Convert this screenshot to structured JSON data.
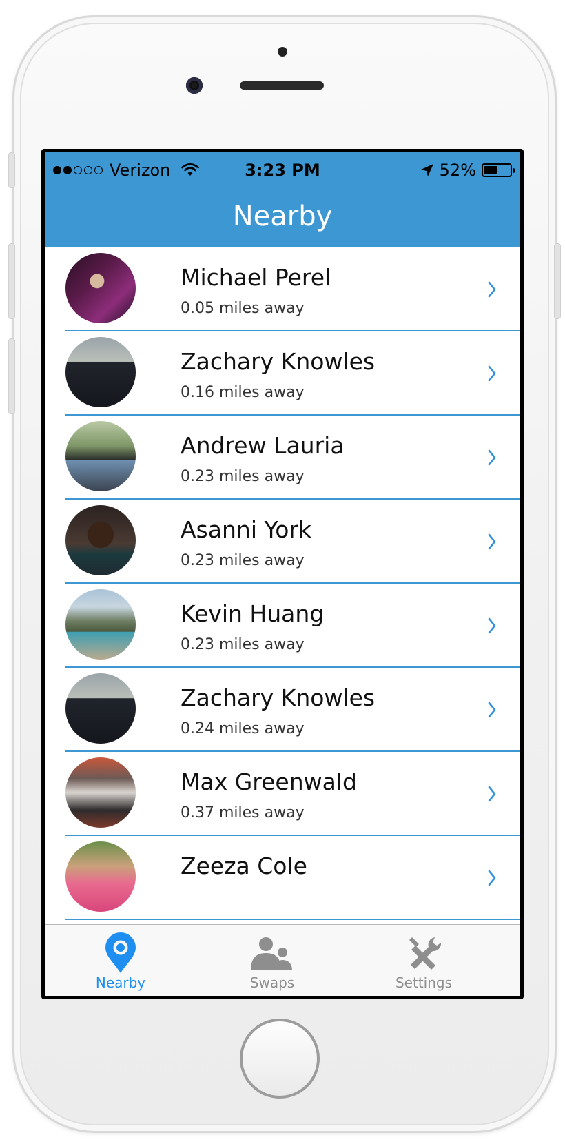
{
  "status_bar": {
    "carrier": "Verizon",
    "signal_bars_filled": 2,
    "signal_bars_total": 5,
    "time": "3:23 PM",
    "battery": "52%",
    "battery_level": 0.52
  },
  "nav": {
    "title": "Nearby"
  },
  "people": [
    {
      "name": "Michael Perel",
      "distance": "0.05 miles away"
    },
    {
      "name": "Zachary Knowles",
      "distance": "0.16 miles away"
    },
    {
      "name": "Andrew Lauria",
      "distance": "0.23 miles away"
    },
    {
      "name": "Asanni York",
      "distance": "0.23 miles away"
    },
    {
      "name": "Kevin Huang",
      "distance": "0.23 miles away"
    },
    {
      "name": "Zachary Knowles",
      "distance": "0.24 miles away"
    },
    {
      "name": "Max Greenwald",
      "distance": "0.37 miles away"
    },
    {
      "name": "Zeeza Cole",
      "distance": ""
    }
  ],
  "tabs": [
    {
      "label": "Nearby",
      "icon": "location-pin-icon",
      "active": true
    },
    {
      "label": "Swaps",
      "icon": "people-icon",
      "active": false
    },
    {
      "label": "Settings",
      "icon": "tools-icon",
      "active": false
    }
  ],
  "colors": {
    "accent": "#3d97d3",
    "tab_active": "#1e8ff0",
    "tab_inactive": "#8e8e8e",
    "chevron": "#2f8fe0"
  }
}
